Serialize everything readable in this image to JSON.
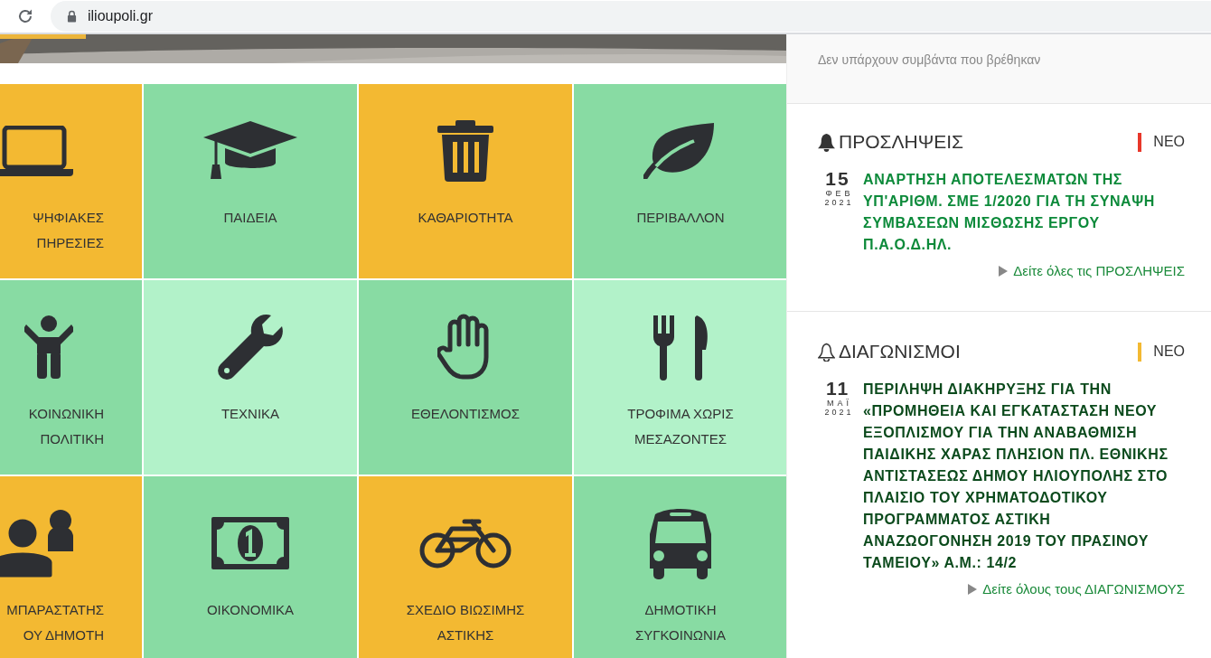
{
  "browser": {
    "url": "ilioupoli.gr"
  },
  "tiles": [
    {
      "kind": "laptop",
      "color": "#f3b932",
      "lines": [
        "ΨΗΦΙΑΚΕΣ",
        "ΠΗΡΕΣΙΕΣ"
      ]
    },
    {
      "kind": "graduation-cap",
      "color": "#88dba3",
      "lines": [
        "ΠΑΙΔΕΙΑ"
      ]
    },
    {
      "kind": "trash",
      "color": "#f3b932",
      "lines": [
        "ΚΑΘΑΡΙΟΤΗΤΑ"
      ]
    },
    {
      "kind": "leaf",
      "color": "#88dba3",
      "lines": [
        "ΠΕΡΙΒΑΛΛΟΝ"
      ]
    },
    {
      "kind": "child",
      "color": "#88dba3",
      "lines": [
        "ΚΟΙΝΩΝΙΚΗ",
        "ΠΟΛΙΤΙΚΗ"
      ]
    },
    {
      "kind": "wrench",
      "color": "#b2f2c9",
      "lines": [
        "ΤΕΧΝΙΚΑ"
      ]
    },
    {
      "kind": "hand",
      "color": "#88dba3",
      "lines": [
        "ΕΘΕΛΟΝΤΙΣΜΟΣ"
      ]
    },
    {
      "kind": "utensils",
      "color": "#b2f2c9",
      "lines": [
        "ΤΡΟΦΙΜΑ ΧΩΡΙΣ",
        "ΜΕΣΑΖΟΝΤΕΣ"
      ]
    },
    {
      "kind": "users",
      "color": "#f3b932",
      "lines": [
        "ΜΠΑΡΑΣΤΑΤΗΣ",
        "ΟΥ ΔΗΜΟΤΗ"
      ]
    },
    {
      "kind": "money",
      "color": "#88dba3",
      "lines": [
        "ΟΙΚΟΝΟΜΙΚΑ"
      ]
    },
    {
      "kind": "bicycle",
      "color": "#f3b932",
      "lines": [
        "ΣΧΕΔΙΟ ΒΙΩΣΙΜΗΣ",
        "ΑΣΤΙΚΗΣ"
      ]
    },
    {
      "kind": "bus",
      "color": "#88dba3",
      "lines": [
        "ΔΗΜΟΤΙΚΗ",
        "ΣΥΓΚΟΙΝΩΝΙΑ"
      ]
    }
  ],
  "events_notice": "Δεν υπάρχουν συμβάντα που βρέθηκαν",
  "sections": [
    {
      "title": "ΠΡΟΣΛΗΨΕΙΣ",
      "kind": "solid",
      "badge": {
        "label": "ΝΕΟ",
        "color": "#e8372a"
      },
      "item": {
        "day": "15",
        "month": "ΦΕΒ",
        "year": "2021",
        "title": "ΑΝΑΡΤΗΣΗ ΑΠΟΤΕΛΕΣΜΑΤΩΝ ΤΗΣ ΥΠ'ΑΡΙΘΜ. ΣΜΕ 1/2020 ΓΙΑ ΤΗ ΣΥΝΑΨΗ ΣΥΜΒΑΣΕΩΝ ΜΙΣΘΩΣΗΣ ΕΡΓΟΥ Π.Α.Ο.Δ.ΗΛ.",
        "color": "#0c8a3a"
      },
      "more_link": "Δείτε όλες τις ΠΡΟΣΛΗΨΕΙΣ"
    },
    {
      "title": "ΔΙΑΓΩΝΙΣΜΟΙ",
      "kind": "outline",
      "badge": {
        "label": "ΝΕΟ",
        "color": "#f3b932"
      },
      "item": {
        "day": "11",
        "month": "ΜΑΪ",
        "year": "2021",
        "title": "ΠΕΡΙΛΗΨΗ ΔΙΑΚΗΡΥΞΗΣ ΓΙΑ ΤΗΝ «ΠΡΟΜΗΘΕΙΑ ΚΑΙ ΕΓΚΑΤΑΣΤΑΣΗ ΝΕΟΥ ΕΞΟΠΛΙΣΜΟΥ ΓΙΑ ΤΗΝ ΑΝΑΒΑΘΜΙΣΗ ΠΑΙΔΙΚΗΣ ΧΑΡΑΣ ΠΛΗΣΙΟΝ ΠΛ. ΕΘΝΙΚΗΣ ΑΝΤΙΣΤΑΣΕΩΣ ΔΗΜΟΥ ΗΛΙΟΥΠΟΛΗΣ ΣΤΟ ΠΛΑΙΣΙΟ ΤΟΥ ΧΡΗΜΑΤΟΔΟΤΙΚΟΥ ΠΡΟΓΡΑΜΜΑΤΟΣ ΑΣΤΙΚΗ ΑΝΑΖΩΟΓΟΝΗΣΗ 2019 ΤΟΥ ΠΡΑΣΙΝΟΥ ΤΑΜΕΙΟΥ» Α.Μ.: 14/2",
        "color": "#0b4a1c"
      },
      "more_link": "Δείτε όλους τους ΔΙΑΓΩΝΙΣΜΟΥΣ"
    }
  ]
}
